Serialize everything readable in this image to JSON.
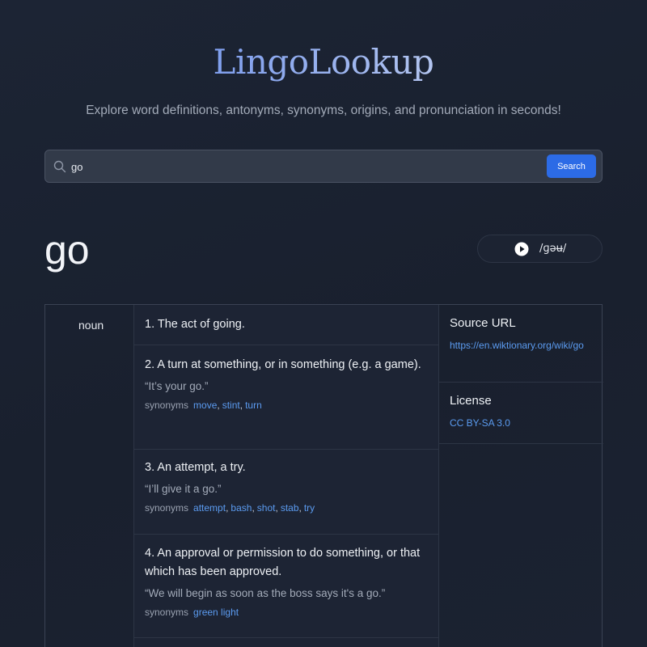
{
  "app": {
    "logo": "LingoLookup",
    "tagline": "Explore word definitions, antonyms, synonyms, origins, and pronunciation in seconds!"
  },
  "search": {
    "value": "go",
    "button_label": "Search"
  },
  "entry": {
    "word": "go",
    "phonetic": "/ɡəʉ/",
    "part_of_speech": "noun",
    "synonyms_label": "synonyms",
    "definitions": [
      {
        "text": "1. The act of going.",
        "example": "",
        "synonyms": []
      },
      {
        "text": "2. A turn at something, or in something (e.g. a game).",
        "example": "“It’s your go.”",
        "synonyms": [
          "move",
          "stint",
          "turn"
        ]
      },
      {
        "text": "3. An attempt, a try.",
        "example": "“I’ll give it a go.”",
        "synonyms": [
          "attempt",
          "bash",
          "shot",
          "stab",
          "try"
        ]
      },
      {
        "text": "4. An approval or permission to do something, or that which has been approved.",
        "example": "“We will begin as soon as the boss says it's a go.”",
        "synonyms": [
          "green light"
        ]
      }
    ]
  },
  "sidebar": {
    "source_heading": "Source URL",
    "source_url": "https://en.wiktionary.org/wiki/go",
    "license_heading": "License",
    "license": "CC BY-SA 3.0"
  }
}
